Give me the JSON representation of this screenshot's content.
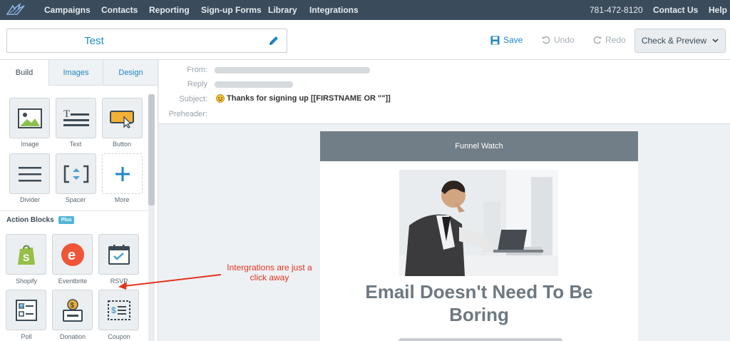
{
  "nav": {
    "items": [
      "Campaigns",
      "Contacts",
      "Reporting",
      "Sign-up Forms",
      "Library",
      "Integrations"
    ],
    "phone": "781-472-8120",
    "contact": "Contact Us",
    "help": "Help"
  },
  "header": {
    "title": "Test",
    "save_label": "Save",
    "undo_label": "Undo",
    "redo_label": "Redo",
    "check_label": "Check & Preview"
  },
  "tabs": [
    "Build",
    "Images",
    "Design"
  ],
  "blocks": [
    {
      "label": "Image",
      "icon": "image-icon"
    },
    {
      "label": "Text",
      "icon": "text-icon"
    },
    {
      "label": "Button",
      "icon": "button-icon"
    },
    {
      "label": "Divider",
      "icon": "divider-icon"
    },
    {
      "label": "Spacer",
      "icon": "spacer-icon"
    },
    {
      "label": "More",
      "icon": "plus-icon"
    }
  ],
  "action_blocks": {
    "title": "Action Blocks",
    "badge": "Plus",
    "items": [
      {
        "label": "Shopify",
        "icon": "shopify-icon"
      },
      {
        "label": "Eventbrite",
        "icon": "eventbrite-icon"
      },
      {
        "label": "RSVP",
        "icon": "calendar-icon"
      },
      {
        "label": "Poll",
        "icon": "poll-icon"
      },
      {
        "label": "Donation",
        "icon": "donation-icon"
      },
      {
        "label": "Coupon",
        "icon": "coupon-icon"
      }
    ]
  },
  "meta": {
    "from_label": "From:",
    "reply_label": "Reply",
    "subject_label": "Subject:",
    "preheader_label": "Preheader:",
    "subject_value": "Thanks for signing up [[FIRSTNAME OR \"\"]]"
  },
  "email": {
    "header": "Funnel Watch",
    "headline_line1": "Email Doesn't Need To Be",
    "headline_line2": "Boring"
  },
  "annotation": {
    "line1": "Intergrations are just a",
    "line2": "click away"
  },
  "colors": {
    "nav_bg": "#3a4b5c",
    "accent": "#1f86c4",
    "annotation": "#e2341f"
  }
}
